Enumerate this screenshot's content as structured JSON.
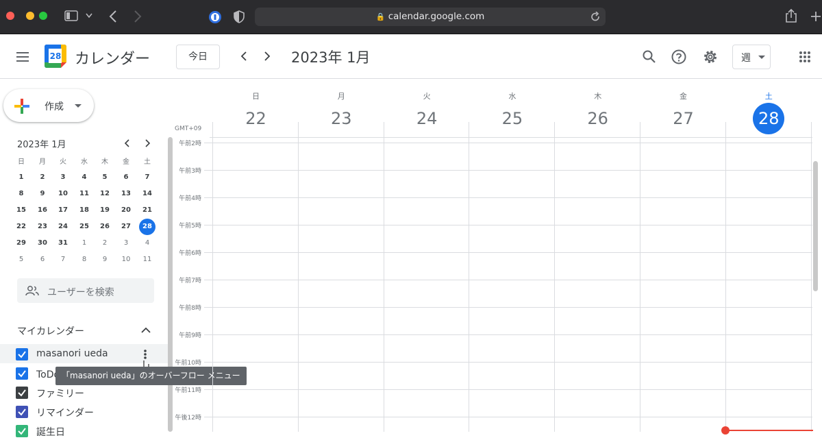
{
  "browser": {
    "url": "calendar.google.com"
  },
  "header": {
    "app_title": "カレンダー",
    "logo_number": "28",
    "today_label": "今日",
    "period_title": "2023年 1月",
    "view_label": "週"
  },
  "sidebar": {
    "create_label": "作成",
    "mini_calendar": {
      "title": "2023年 1月",
      "weekdays": [
        "日",
        "月",
        "火",
        "水",
        "木",
        "金",
        "土"
      ],
      "weeks": [
        [
          "1",
          "2",
          "3",
          "4",
          "5",
          "6",
          "7"
        ],
        [
          "8",
          "9",
          "10",
          "11",
          "12",
          "13",
          "14"
        ],
        [
          "15",
          "16",
          "17",
          "18",
          "19",
          "20",
          "21"
        ],
        [
          "22",
          "23",
          "24",
          "25",
          "26",
          "27",
          "28"
        ],
        [
          "29",
          "30",
          "31",
          "1",
          "2",
          "3",
          "4"
        ],
        [
          "5",
          "6",
          "7",
          "8",
          "9",
          "10",
          "11"
        ]
      ],
      "today": "28"
    },
    "search_people_placeholder": "ユーザーを検索",
    "my_calendars_title": "マイカレンダー",
    "calendars": [
      {
        "label": "masanori ueda",
        "color": "#1a73e8"
      },
      {
        "label": "ToDo リスト",
        "color": "#1a73e8"
      },
      {
        "label": "ファミリー",
        "color": "#3c4043"
      },
      {
        "label": "リマインダー",
        "color": "#3f51b5"
      },
      {
        "label": "誕生日",
        "color": "#33b679"
      }
    ]
  },
  "tooltip": {
    "text": "「masanori ueda」のオーバーフロー メニュー"
  },
  "week": {
    "timezone": "GMT+09",
    "days": [
      {
        "dow": "日",
        "date": "22"
      },
      {
        "dow": "月",
        "date": "23"
      },
      {
        "dow": "火",
        "date": "24"
      },
      {
        "dow": "水",
        "date": "25"
      },
      {
        "dow": "木",
        "date": "26"
      },
      {
        "dow": "金",
        "date": "27"
      },
      {
        "dow": "土",
        "date": "28"
      }
    ],
    "today_index": 6,
    "hours": [
      "午前2時",
      "午前3時",
      "午前4時",
      "午前5時",
      "午前6時",
      "午前7時",
      "午前8時",
      "午前9時",
      "午前10時",
      "午前11時",
      "午後12時"
    ]
  },
  "colors": {
    "accent": "#1a73e8",
    "now_line": "#ea4335"
  }
}
